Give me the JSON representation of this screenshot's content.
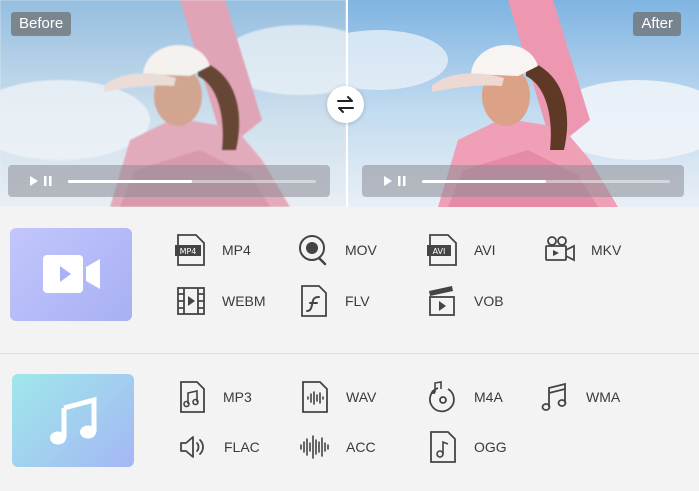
{
  "preview": {
    "before_label": "Before",
    "after_label": "After",
    "progress": 0.5
  },
  "video_formats": [
    {
      "label": "MP4",
      "icon": "mp4-file-icon",
      "badge": "MP4"
    },
    {
      "label": "MOV",
      "icon": "mov-icon"
    },
    {
      "label": "AVI",
      "icon": "avi-file-icon",
      "badge": "AVI"
    },
    {
      "label": "MKV",
      "icon": "video-camera-icon"
    },
    {
      "label": "WEBM",
      "icon": "film-strip-icon"
    },
    {
      "label": "FLV",
      "icon": "flash-file-icon"
    },
    {
      "label": "VOB",
      "icon": "clapperboard-icon"
    }
  ],
  "audio_formats": [
    {
      "label": "MP3",
      "icon": "music-file-icon"
    },
    {
      "label": "WAV",
      "icon": "waveform-file-icon"
    },
    {
      "label": "M4A",
      "icon": "music-disc-icon"
    },
    {
      "label": "WMA",
      "icon": "music-note-icon"
    },
    {
      "label": "FLAC",
      "icon": "speaker-icon"
    },
    {
      "label": "ACC",
      "icon": "sound-wave-icon"
    },
    {
      "label": "OGG",
      "icon": "music-note-file-icon"
    }
  ],
  "colors": {
    "video_hero": "#b3b9f7",
    "audio_hero": "#a1cdf0",
    "icon_stroke": "#444444",
    "label_text": "#3a3a3a"
  }
}
